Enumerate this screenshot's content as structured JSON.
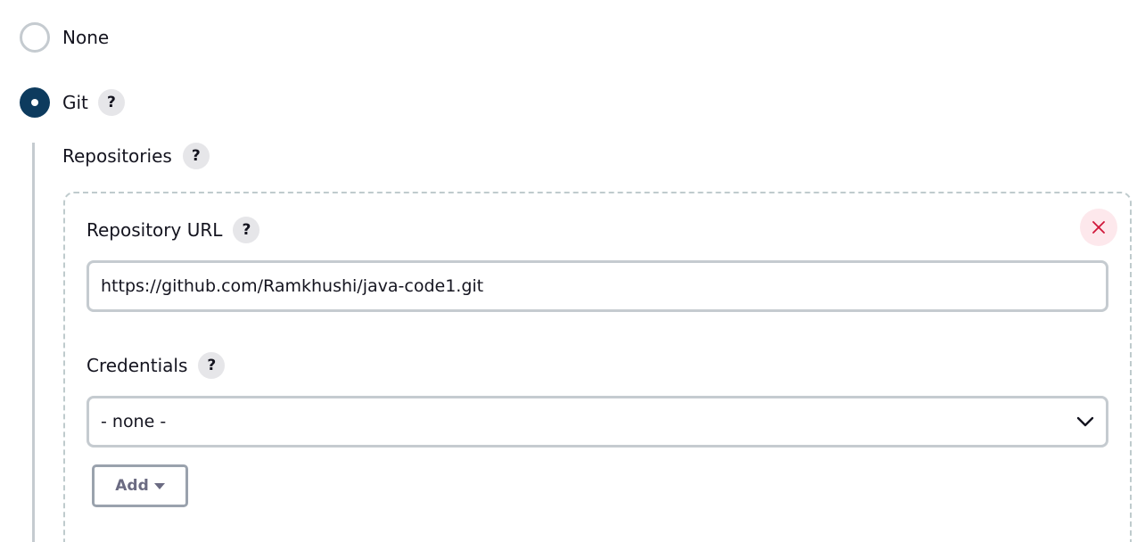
{
  "scm": {
    "options": [
      {
        "label": "None",
        "selected": false
      },
      {
        "label": "Git",
        "selected": true
      }
    ],
    "help_glyph": "?"
  },
  "git": {
    "repositories_label": "Repositories",
    "repository_url_label": "Repository URL",
    "repository_url_value": "https://github.com/Ramkhushi/java-code1.git",
    "credentials_label": "Credentials",
    "credentials_selected": "- none -",
    "add_button_label": "Add"
  },
  "icons": {
    "close": "close-icon",
    "dropdown": "chevron-down-icon",
    "add_caret": "caret-down-icon"
  },
  "colors": {
    "radio_selected": "#0d3b5e",
    "radio_border": "#c5cbd0",
    "close_bg": "#fde8ec",
    "close_x": "#d0173a",
    "add_text": "#6b6b82"
  }
}
